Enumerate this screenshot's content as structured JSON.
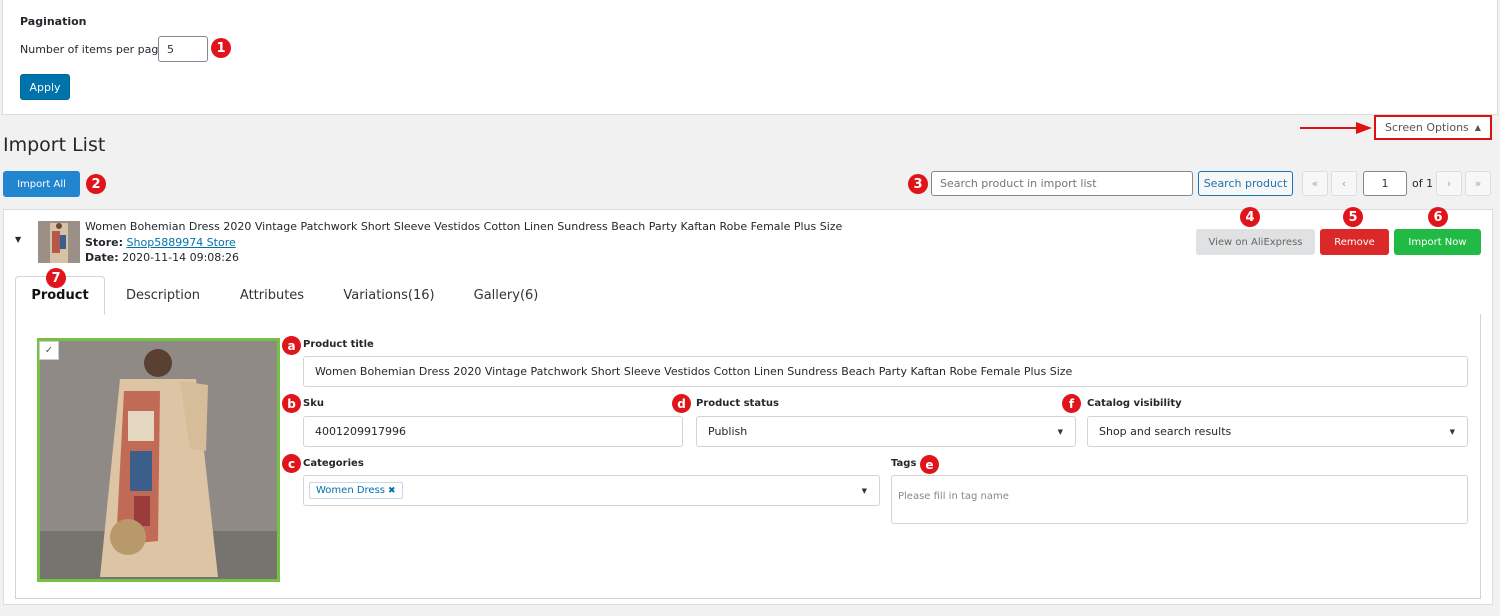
{
  "screen_options": {
    "heading": "Pagination",
    "items_label": "Number of items per page",
    "items_value": "5",
    "apply_label": "Apply",
    "toggle_label": "Screen Options"
  },
  "header": {
    "title": "Import List",
    "import_all_label": "Import All"
  },
  "search": {
    "placeholder": "Search product in import list",
    "button_label": "Search product"
  },
  "pagination": {
    "first": "«",
    "prev": "‹",
    "current": "1",
    "of_text": "of 1",
    "next": "›",
    "last": "»"
  },
  "product": {
    "title": "Women Bohemian Dress 2020 Vintage Patchwork Short Sleeve Vestidos Cotton Linen Sundress Beach Party Kaftan Robe Female Plus Size",
    "store_label": "Store:",
    "store_name": "Shop5889974 Store",
    "date_label": "Date:",
    "date_value": "2020-11-14 09:08:26",
    "view_label": "View on AliExpress",
    "remove_label": "Remove",
    "import_now_label": "Import Now"
  },
  "tabs": [
    {
      "label": "Product",
      "active": true
    },
    {
      "label": "Description"
    },
    {
      "label": "Attributes"
    },
    {
      "label": "Variations(16)"
    },
    {
      "label": "Gallery(6)"
    }
  ],
  "form": {
    "title_label": "Product title",
    "title_value": "Women Bohemian Dress 2020 Vintage Patchwork Short Sleeve Vestidos Cotton Linen Sundress Beach Party Kaftan Robe Female Plus Size",
    "sku_label": "Sku",
    "sku_value": "4001209917996",
    "status_label": "Product status",
    "status_value": "Publish",
    "visibility_label": "Catalog visibility",
    "visibility_value": "Shop and search results",
    "categories_label": "Categories",
    "category_chip": "Women Dress",
    "tags_label": "Tags",
    "tags_placeholder": "Please fill in tag name"
  },
  "annotations": {
    "n1": "1",
    "n2": "2",
    "n3": "3",
    "n4": "4",
    "n5": "5",
    "n6": "6",
    "n7": "7",
    "a": "a",
    "b": "b",
    "c": "c",
    "d": "d",
    "e": "e",
    "f": "f"
  },
  "colors": {
    "primary": "#0073aa",
    "import_all": "#2185d0",
    "remove": "#db2828",
    "import_now": "#21ba45",
    "badge_red": "#e0151b",
    "gallery_border": "#76c043"
  }
}
